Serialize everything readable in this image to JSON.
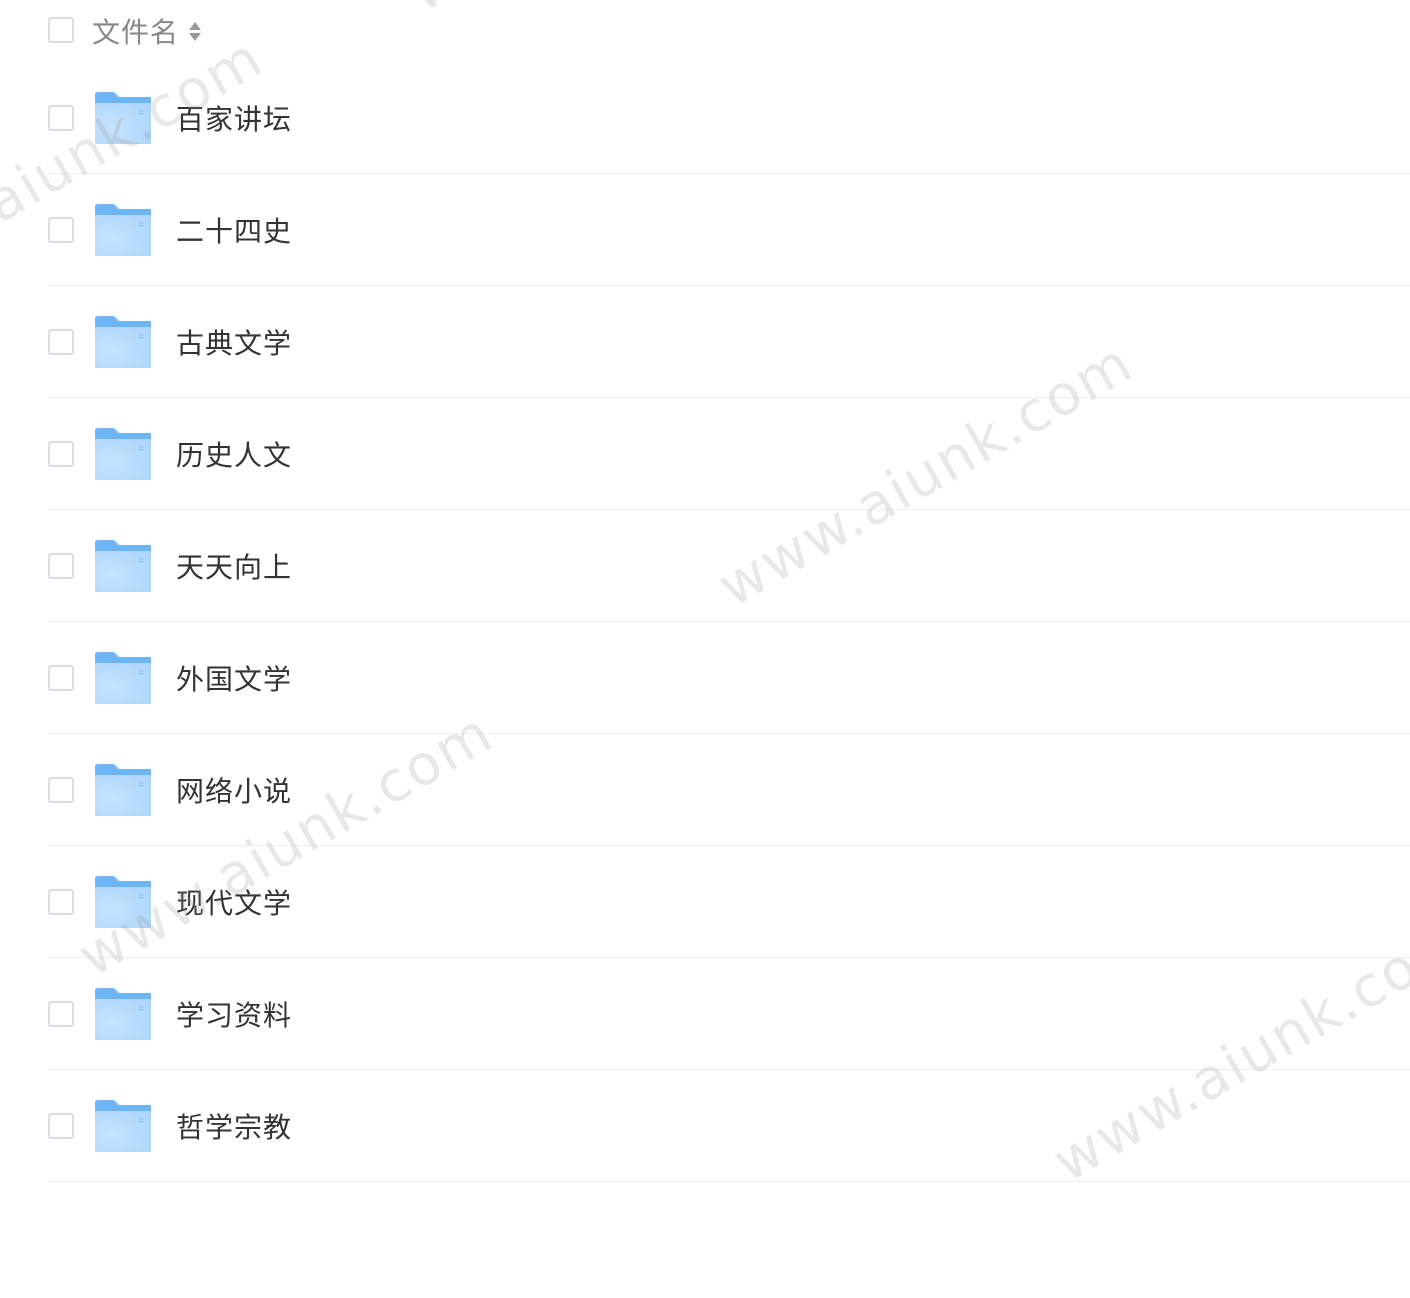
{
  "header": {
    "column_label": "文件名",
    "sort_icon": "sort-icon"
  },
  "folders": [
    {
      "name": "百家讲坛",
      "icon": "folder-icon"
    },
    {
      "name": "二十四史",
      "icon": "folder-icon"
    },
    {
      "name": "古典文学",
      "icon": "folder-icon"
    },
    {
      "name": "历史人文",
      "icon": "folder-icon"
    },
    {
      "name": "天天向上",
      "icon": "folder-icon"
    },
    {
      "name": "外国文学",
      "icon": "folder-icon"
    },
    {
      "name": "网络小说",
      "icon": "folder-icon"
    },
    {
      "name": "现代文学",
      "icon": "folder-icon"
    },
    {
      "name": "学习资料",
      "icon": "folder-icon"
    },
    {
      "name": "哲学宗教",
      "icon": "folder-icon"
    }
  ],
  "watermark": {
    "w1": "www.aiunk.com",
    "w2": "www.aiunk.com",
    "w3": "www.aiunk.com",
    "w4": "www.aiunk.com",
    "w5": "www.aiunk.com"
  },
  "colors": {
    "folder_front": "#a9d4fb",
    "folder_back": "#6db5f5",
    "divider": "#eef0f3",
    "checkbox_border": "#d9dde3"
  }
}
